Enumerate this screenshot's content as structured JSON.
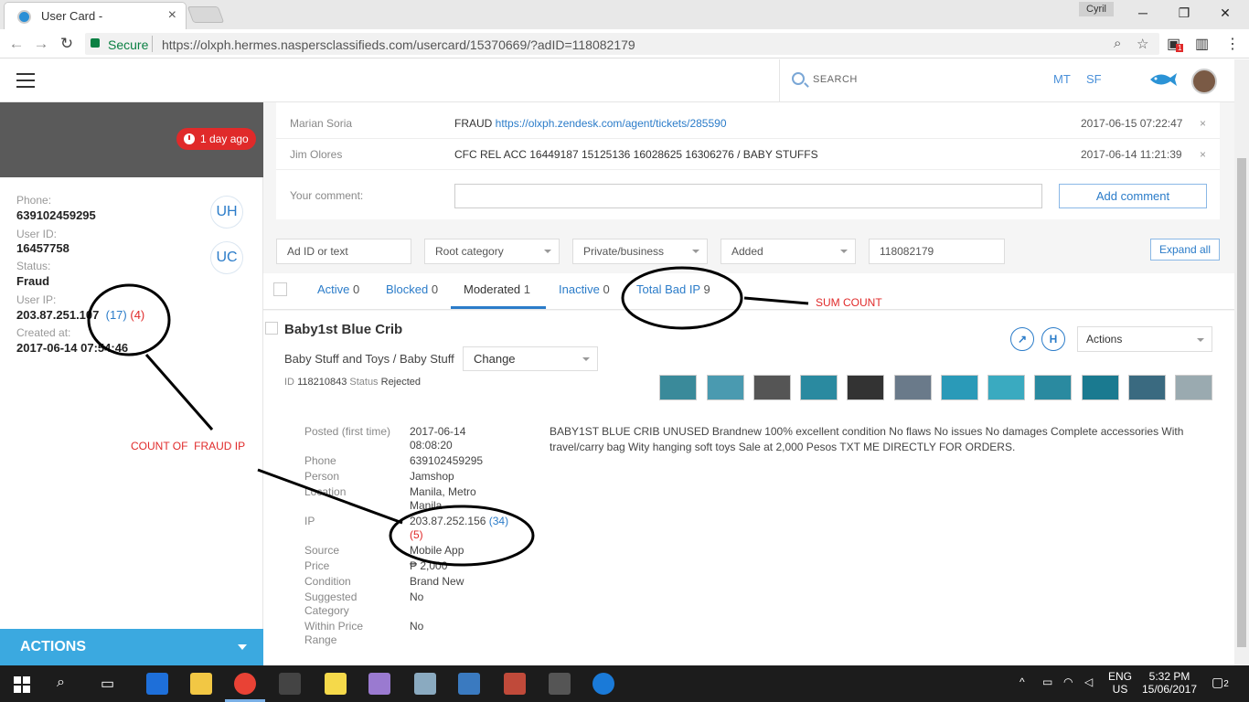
{
  "browser": {
    "tab_title": "User Card -",
    "user_chip": "Cyril",
    "secure_label": "Secure",
    "url_scheme": "https://",
    "url_host": "olxph.hermes.naspersclassifieds.com",
    "url_path": "/usercard/15370669/?adID=118082179",
    "ext_badge": "1"
  },
  "header": {
    "search_label": "SEARCH",
    "initials": [
      "MT",
      "SF"
    ]
  },
  "sidebar": {
    "time_badge": "1 day ago",
    "phone_label": "Phone:",
    "phone_value": "639102459295",
    "userid_label": "User ID:",
    "userid_value": "16457758",
    "status_label": "Status:",
    "status_value": "Fraud",
    "ip_label": "User IP:",
    "ip_value": "203.87.251.107",
    "ip_count_blue": "(17)",
    "ip_count_red": "(4)",
    "created_label": "Created at:",
    "created_value": "2017-06-14 07:54:46",
    "btn_uh": "UH",
    "btn_uc": "UC",
    "actions_label": "ACTIONS"
  },
  "comments": [
    {
      "author": "Marian Soria",
      "text_prefix": "FRAUD ",
      "link": "https://olxph.zendesk.com/agent/tickets/285590",
      "date": "2017-06-15 07:22:47",
      "x": "×"
    },
    {
      "author": "Jim Olores",
      "text_prefix": "CFC REL ACC 16449187 15125136 16028625 16306276 / BABY STUFFS",
      "link": "",
      "date": "2017-06-14 11:21:39",
      "x": "×"
    }
  ],
  "comment_form": {
    "label": "Your comment:",
    "button": "Add comment"
  },
  "filters": {
    "ad_id_placeholder": "Ad ID or text",
    "root_category": "Root category",
    "private_business": "Private/business",
    "added": "Added",
    "ad_id_value": "118082179",
    "expand_all": "Expand all"
  },
  "tabs": [
    {
      "label": "Active",
      "count": "0"
    },
    {
      "label": "Blocked",
      "count": "0"
    },
    {
      "label": "Moderated",
      "count": "1"
    },
    {
      "label": "Inactive",
      "count": "0"
    },
    {
      "label": "Total Bad IP",
      "count": "9"
    }
  ],
  "ad": {
    "title": "Baby1st Blue Crib",
    "category": "Baby Stuff and Toys / Baby Stuff",
    "change_label": "Change",
    "id_label": "ID",
    "id_value": "118210843",
    "status_label": "Status",
    "status_value": "Rejected",
    "btn_h": "H",
    "actions_label": "Actions",
    "details": [
      {
        "label": "Posted (first time)",
        "value": "2017-06-14 08:08:20"
      },
      {
        "label": "Phone",
        "value": "639102459295"
      },
      {
        "label": "Person",
        "value": "Jamshop"
      },
      {
        "label": "Location",
        "value": "Manila, Metro Manila"
      },
      {
        "label": "IP",
        "value": "203.87.252.156"
      },
      {
        "label": "Source",
        "value": "Mobile App"
      },
      {
        "label": "Price",
        "value": "₱ 2,000"
      },
      {
        "label": "Condition",
        "value": "Brand New"
      },
      {
        "label": "Suggested Category",
        "value": "No"
      },
      {
        "label": "Within Price Range",
        "value": "No"
      }
    ],
    "ip_count_blue": "(34)",
    "ip_count_red": "(5)",
    "description": "BABY1ST BLUE CRIB UNUSED Brandnew 100% excellent condition No flaws No issues No damages Complete accessories With travel/carry bag Wity hanging soft toys Sale at 2,000 Pesos TXT ME DIRECTLY FOR ORDERS."
  },
  "annotations": {
    "sum_count": "SUM COUNT",
    "count_fraud_ip": "COUNT OF  FRAUD IP"
  },
  "taskbar": {
    "lang_top": "ENG",
    "lang_bottom": "US",
    "time": "5:32 PM",
    "date": "15/06/2017",
    "notif": "2"
  }
}
